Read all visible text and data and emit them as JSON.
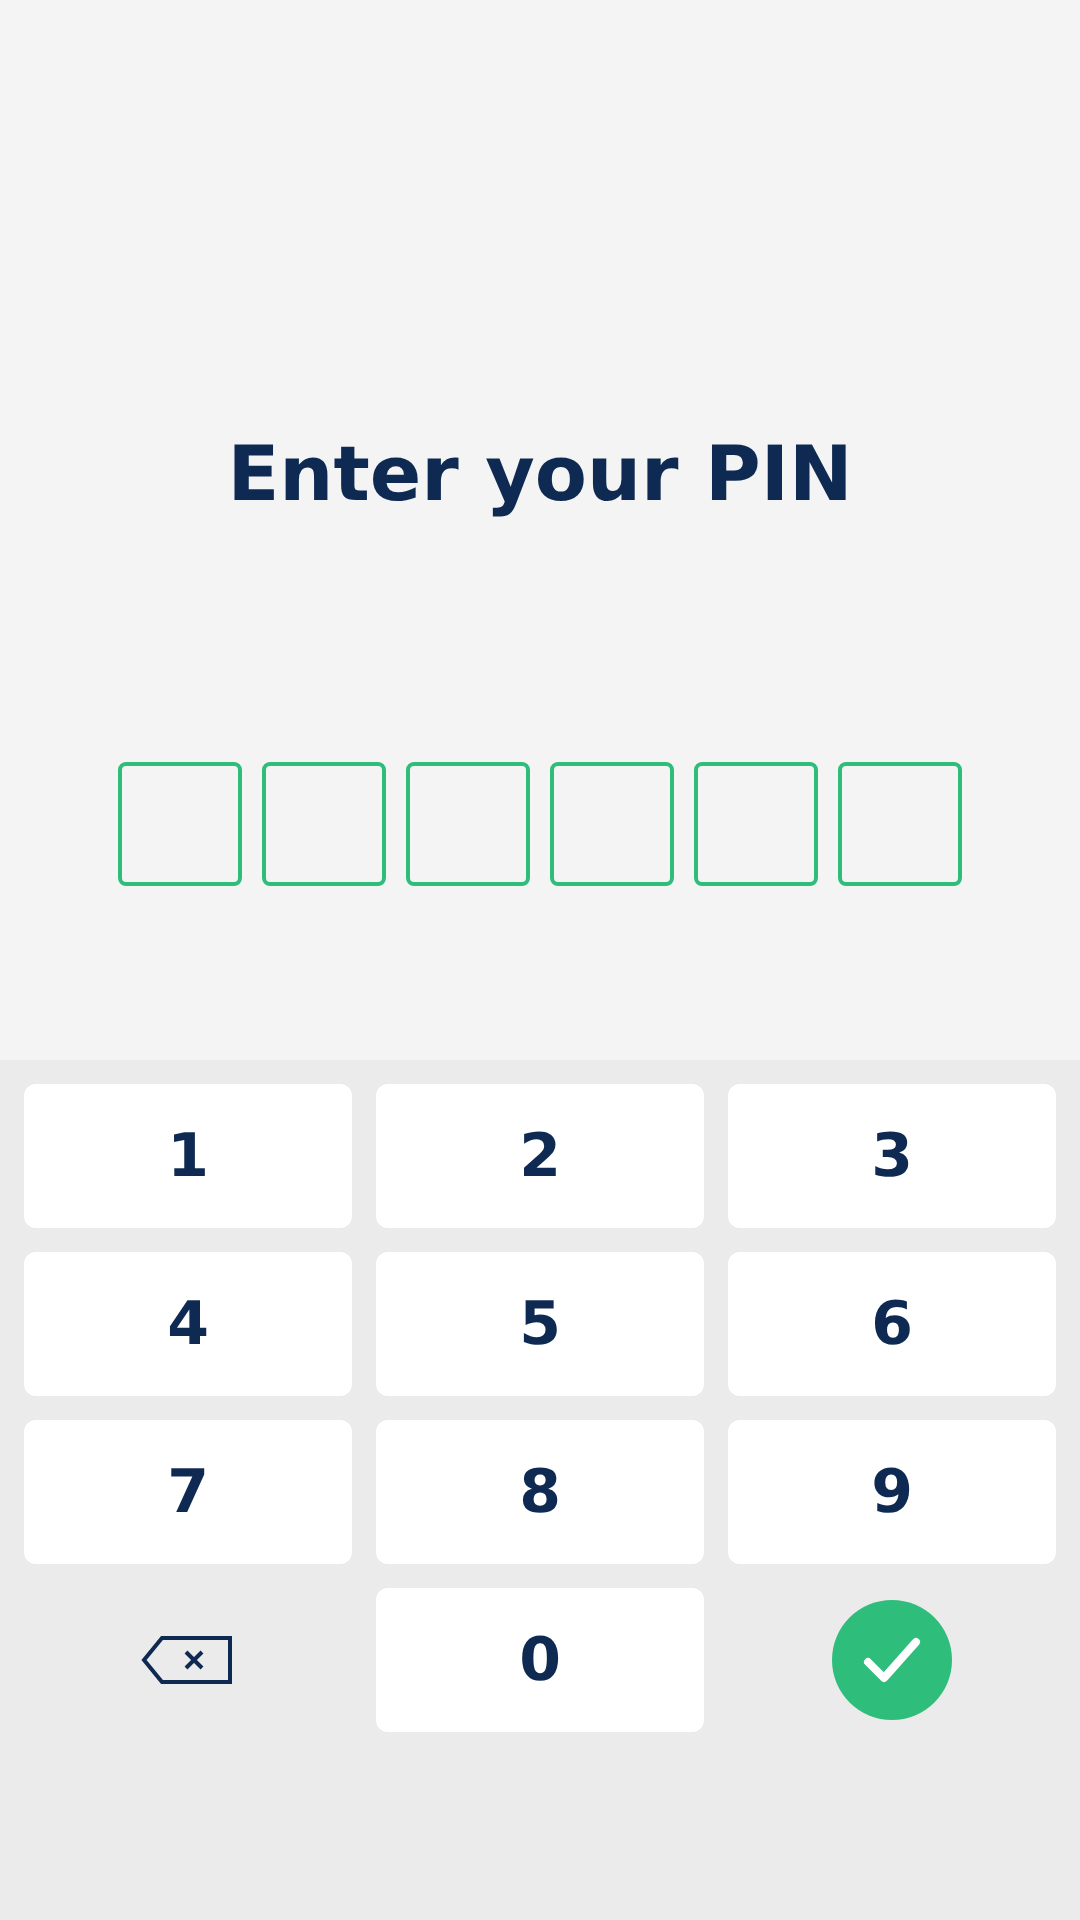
{
  "title": "Enter your PIN",
  "pin_fields": [
    {
      "filled": false
    },
    {
      "filled": false
    },
    {
      "filled": false
    },
    {
      "filled": false
    },
    {
      "filled": false
    },
    {
      "filled": false
    }
  ],
  "keys": [
    {
      "kind": "digit",
      "label": "1"
    },
    {
      "kind": "digit",
      "label": "2"
    },
    {
      "kind": "digit",
      "label": "3"
    },
    {
      "kind": "digit",
      "label": "4"
    },
    {
      "kind": "digit",
      "label": "5"
    },
    {
      "kind": "digit",
      "label": "6"
    },
    {
      "kind": "digit",
      "label": "7"
    },
    {
      "kind": "digit",
      "label": "8"
    },
    {
      "kind": "digit",
      "label": "9"
    },
    {
      "kind": "backspace"
    },
    {
      "kind": "digit",
      "label": "0"
    },
    {
      "kind": "confirm"
    }
  ]
}
